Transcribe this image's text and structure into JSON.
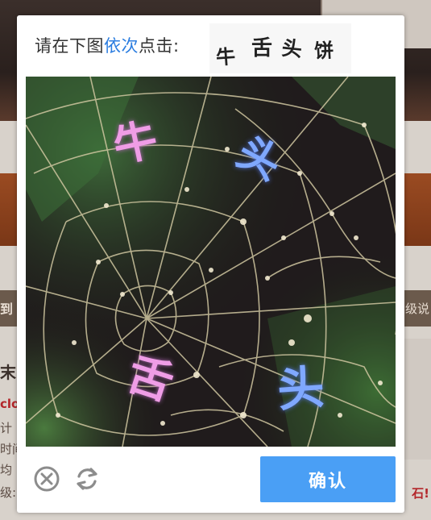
{
  "captcha": {
    "prompt_prefix": "请在下图",
    "prompt_highlight": "依次",
    "prompt_suffix": "点击:",
    "target_chars": [
      "牛",
      "舌",
      "头",
      "饼"
    ],
    "puzzle_chars": [
      "牛",
      "头",
      "舌",
      "头"
    ],
    "confirm_label": "确认",
    "close_icon": "close-circle-icon",
    "refresh_icon": "refresh-icon",
    "colors": {
      "accent": "#4a9ff5",
      "highlight_text": "#2b7de0",
      "pink_char": "#ef9de6",
      "blue_char": "#7fa8ff"
    }
  },
  "background_page": {
    "strip_left": "到",
    "strip_right": "级说",
    "left_line_1": "末",
    "left_line_2": "clo",
    "left_line_3": "计",
    "left_line_4": "时间",
    "left_line_5": "均",
    "left_line_6": "级:",
    "right_red": "石!"
  }
}
